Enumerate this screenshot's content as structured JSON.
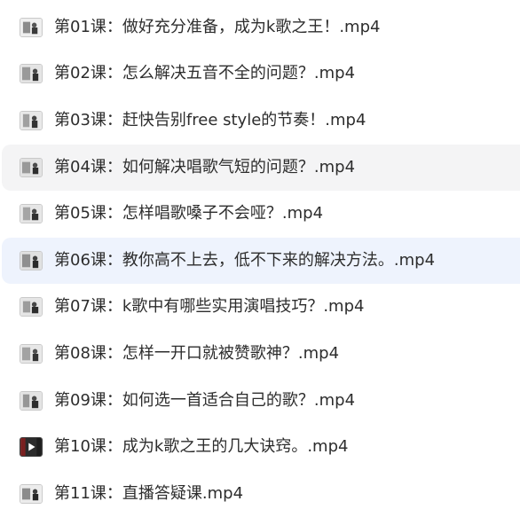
{
  "files": [
    {
      "name": "第01课：做好充分准备，成为k歌之王！.mp4",
      "thumb_icon": "video-thumbnail-icon",
      "state": "normal"
    },
    {
      "name": "第02课：怎么解决五音不全的问题？.mp4",
      "thumb_icon": "video-thumbnail-icon",
      "state": "normal"
    },
    {
      "name": "第03课：赶快告别free style的节奏！.mp4",
      "thumb_icon": "video-thumbnail-icon",
      "state": "normal"
    },
    {
      "name": "第04课：如何解决唱歌气短的问题？.mp4",
      "thumb_icon": "video-thumbnail-icon",
      "state": "hover"
    },
    {
      "name": "第05课：怎样唱歌嗓子不会哑？.mp4",
      "thumb_icon": "video-thumbnail-icon",
      "state": "normal"
    },
    {
      "name": "第06课：教你高不上去，低不下来的解决方法。.mp4",
      "thumb_icon": "video-thumbnail-icon",
      "state": "selected"
    },
    {
      "name": "第07课：k歌中有哪些实用演唱技巧？.mp4",
      "thumb_icon": "video-thumbnail-icon",
      "state": "normal"
    },
    {
      "name": "第08课：怎样一开口就被赞歌神？.mp4",
      "thumb_icon": "video-thumbnail-icon",
      "state": "normal"
    },
    {
      "name": "第09课：如何选一首适合自己的歌？.mp4",
      "thumb_icon": "video-thumbnail-icon",
      "state": "normal"
    },
    {
      "name": "第10课：成为k歌之王的几大诀窍。.mp4",
      "thumb_icon": "video-play-thumbnail-icon",
      "state": "normal"
    },
    {
      "name": "第11课：直播答疑课.mp4",
      "thumb_icon": "video-thumbnail-icon",
      "state": "normal"
    }
  ],
  "colors": {
    "text": "#2d2d2d",
    "hover_background": "#f4f4f5",
    "selected_background": "#eef3fd"
  }
}
